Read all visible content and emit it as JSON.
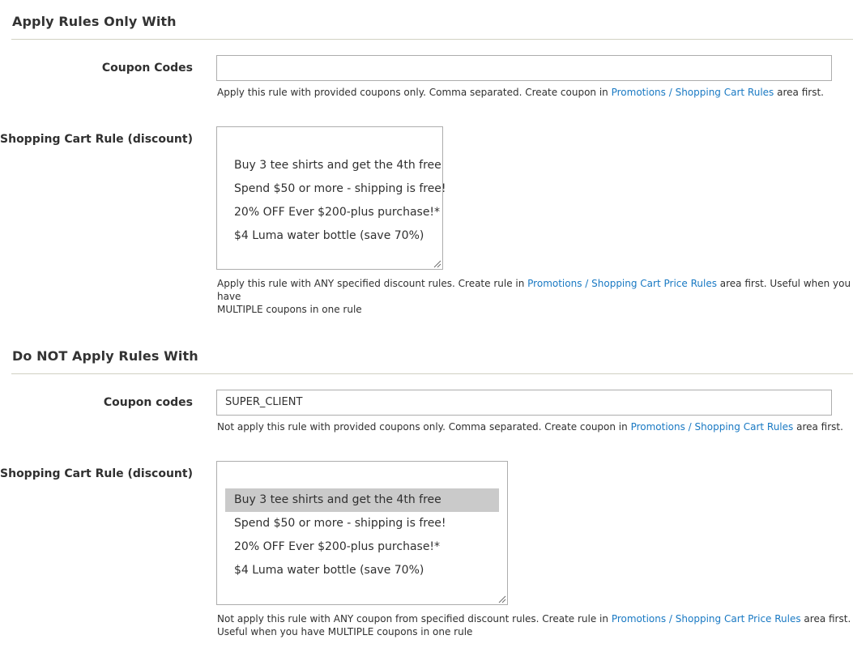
{
  "apply_only": {
    "title": "Apply Rules Only With",
    "coupon_label": "Coupon Codes",
    "coupon_value": "",
    "coupon_note_pre": "Apply this rule with provided coupons only. Comma separated. Create coupon in ",
    "coupon_note_link": "Promotions / Shopping Cart Rules",
    "coupon_note_post": " area first.",
    "rule_label": "Shopping Cart Rule (discount)",
    "rule_options": [
      {
        "label": "Buy 3 tee shirts and get the 4th free",
        "selected": false
      },
      {
        "label": "Spend $50 or more - shipping is free!",
        "selected": false
      },
      {
        "label": "20% OFF Ever $200-plus purchase!*",
        "selected": false
      },
      {
        "label": "$4 Luma water bottle (save 70%)",
        "selected": false
      }
    ],
    "rule_note_line1_pre": "Apply this rule with ANY specified discount rules. Create rule in ",
    "rule_note_link": "Promotions / Shopping Cart Price Rules",
    "rule_note_line1_post": " area first. Useful when you have",
    "rule_note_line2": "MULTIPLE coupons in one rule"
  },
  "do_not_apply": {
    "title": "Do NOT Apply Rules With",
    "coupon_label": "Coupon codes",
    "coupon_value": "SUPER_CLIENT",
    "coupon_note_pre": "Not apply this rule with provided coupons only. Comma separated. Create coupon in ",
    "coupon_note_link": "Promotions / Shopping Cart Rules",
    "coupon_note_post": " area first.",
    "rule_label": "Shopping Cart Rule (discount)",
    "rule_options": [
      {
        "label": "Buy 3 tee shirts and get the 4th free",
        "selected": true
      },
      {
        "label": "Spend $50 or more - shipping is free!",
        "selected": false
      },
      {
        "label": "20% OFF Ever $200-plus purchase!*",
        "selected": false
      },
      {
        "label": "$4 Luma water bottle (save 70%)",
        "selected": false
      }
    ],
    "rule_note_line1_pre": "Not apply this rule with ANY coupon from specified discount rules. Create rule in ",
    "rule_note_link": "Promotions / Shopping Cart Price Rules",
    "rule_note_line1_post": " area first.",
    "rule_note_line2": "Useful when you have MULTIPLE coupons in one rule"
  },
  "colors": {
    "link": "#1979c3",
    "selected_option_bg": "#cacaca",
    "input_border": "#adadad",
    "divider": "#d1d1c3"
  }
}
